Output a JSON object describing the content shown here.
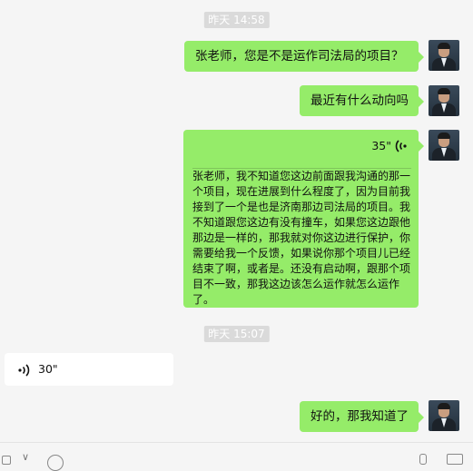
{
  "messages": {
    "ts1": "昨天 14:58",
    "m1": "张老师，您是不是运作司法局的项目？",
    "m2": "最近有什么动向吗",
    "voice1": {
      "duration": "35\"",
      "transcript": "张老师，我不知道您这边前面跟我沟通的那一个项目，现在进展到什么程度了，因为目前我接到了一个是也是济南那边司法局的项目。我不知道跟您这边有没有撞车，如果您这边跟他那边是一样的，那我就对你这边进行保护，你需要给我一个反馈，如果说你那个项目儿已经结束了啊，或者是。还没有启动啊，跟那个项目不一致，那我这边该怎么运作就怎么运作了。"
    },
    "ts2": "昨天 15:07",
    "voice2": {
      "duration": "30\""
    },
    "m3": "好的，那我知道了"
  },
  "icons": {
    "voice": "voice-wave-icon",
    "avatar": "user-avatar"
  },
  "colors": {
    "bubble_self": "#95ec69",
    "bubble_other": "#ffffff",
    "background": "#f5f5f5",
    "timestamp_bg": "#dadada"
  }
}
